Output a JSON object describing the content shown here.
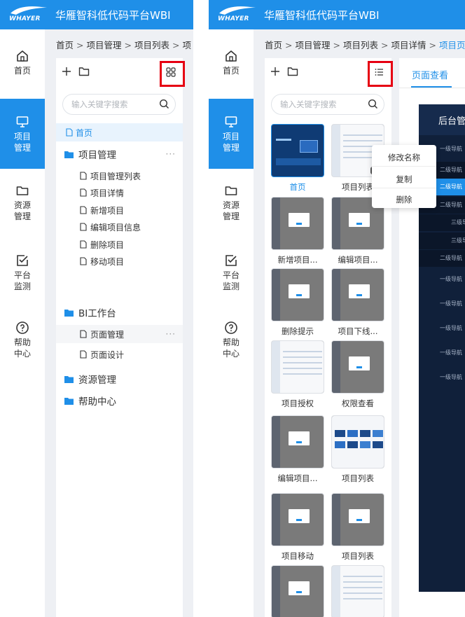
{
  "app": {
    "title": "华雁智科低代码平台WBI",
    "logo_text": "WHAYER"
  },
  "nav": [
    {
      "label": "首页",
      "icon": "home-icon"
    },
    {
      "label": "项目管理",
      "icon": "monitor-icon",
      "active": true
    },
    {
      "label": "资源管理",
      "icon": "folder-icon"
    },
    {
      "label": "平台监测",
      "icon": "checkbox-icon"
    },
    {
      "label": "帮助中心",
      "icon": "help-icon"
    }
  ],
  "left": {
    "breadcrumb": [
      "首页",
      "项目管理",
      "项目列表",
      "项"
    ],
    "search_placeholder": "输入关键字搜索",
    "tree": {
      "home": "首页",
      "groups": [
        {
          "label": "项目管理",
          "more": "···",
          "children": [
            "项目管理列表",
            "项目详情",
            "新增项目",
            "编辑项目信息",
            "删除项目",
            "移动项目"
          ]
        },
        {
          "label": "BI工作台",
          "children": [
            {
              "label": "页面管理",
              "more": "···"
            },
            {
              "label": "页面设计"
            }
          ]
        },
        {
          "label": "资源管理"
        },
        {
          "label": "帮助中心"
        }
      ]
    }
  },
  "right": {
    "breadcrumb": [
      "首页",
      "项目管理",
      "项目列表",
      "项目详情",
      "项目页"
    ],
    "search_placeholder": "输入关键字搜索",
    "thumbs": [
      {
        "label": "首页",
        "selected": true
      },
      {
        "label": "项目列表",
        "more": "···"
      },
      {
        "label": "新增项目..."
      },
      {
        "label": "编辑项目..."
      },
      {
        "label": "删除提示"
      },
      {
        "label": "项目下线..."
      },
      {
        "label": "项目授权"
      },
      {
        "label": "权限查看"
      },
      {
        "label": "编辑项目..."
      },
      {
        "label": "项目列表"
      },
      {
        "label": "项目移动"
      },
      {
        "label": "项目列表"
      },
      {
        "label": ""
      },
      {
        "label": ""
      }
    ],
    "context_menu": [
      "修改名称",
      "复制",
      "删除"
    ],
    "preview": {
      "tab": "页面查看",
      "header": "后台管",
      "menu": [
        "一级导航",
        "二级导航",
        "二级导航",
        "二级导航",
        "三级导",
        "三级导",
        "二级导航",
        "一级导航",
        "一级导航",
        "一级导航",
        "一级导航",
        "一级导航"
      ]
    }
  },
  "colors": {
    "primary": "#1f8fe8",
    "highlight": "#e60012",
    "dark": "#10203a"
  }
}
